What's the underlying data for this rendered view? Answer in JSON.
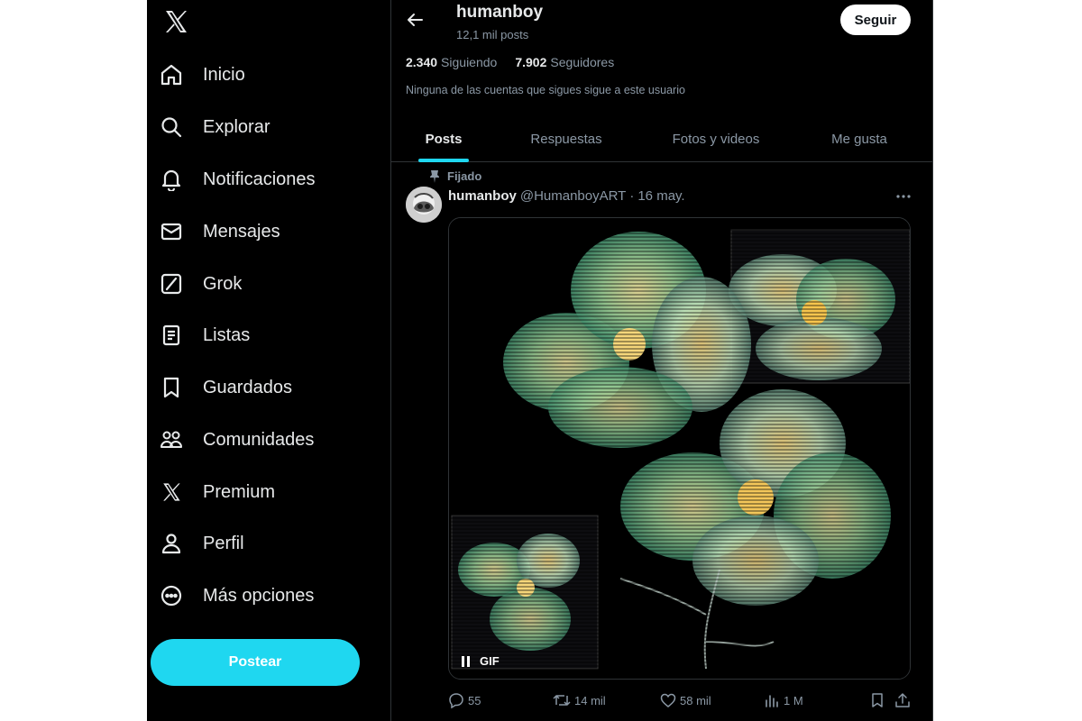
{
  "sidebar": {
    "logo": "x-logo-icon",
    "items": [
      {
        "label": "Inicio",
        "icon": "home-icon"
      },
      {
        "label": "Explorar",
        "icon": "search-icon"
      },
      {
        "label": "Notificaciones",
        "icon": "bell-icon"
      },
      {
        "label": "Mensajes",
        "icon": "mail-icon"
      },
      {
        "label": "Grok",
        "icon": "grok-icon"
      },
      {
        "label": "Listas",
        "icon": "list-icon"
      },
      {
        "label": "Guardados",
        "icon": "bookmark-icon"
      },
      {
        "label": "Comunidades",
        "icon": "communities-icon"
      },
      {
        "label": "Premium",
        "icon": "x-premium-icon"
      },
      {
        "label": "Perfil",
        "icon": "profile-icon"
      },
      {
        "label": "Más opciones",
        "icon": "more-options-icon"
      }
    ],
    "post_button": "Postear"
  },
  "header": {
    "name": "humanboy",
    "posts_count": "12,1 mil posts",
    "follow_button": "Seguir"
  },
  "profile": {
    "following_count": "2.340",
    "following_label": "Siguiendo",
    "followers_count": "7.902",
    "followers_label": "Seguidores",
    "mutual_note": "Ninguna de las cuentas que sigues sigue a este usuario"
  },
  "tabs": [
    {
      "label": "Posts",
      "active": true
    },
    {
      "label": "Respuestas",
      "active": false
    },
    {
      "label": "Fotos y videos",
      "active": false
    },
    {
      "label": "Me gusta",
      "active": false
    }
  ],
  "post": {
    "pinned_label": "Fijado",
    "author_name": "humanboy",
    "handle": "@HumanboyART",
    "separator": "·",
    "date": "16 may.",
    "media_badge": "GIF",
    "replies": "55",
    "reposts": "14 mil",
    "likes": "58 mil",
    "views": "1 M"
  },
  "colors": {
    "accent": "#1fd7f0",
    "background": "#000000",
    "text_primary": "#e7e9ea",
    "text_secondary": "#8b98a5",
    "border": "#2f3336"
  }
}
